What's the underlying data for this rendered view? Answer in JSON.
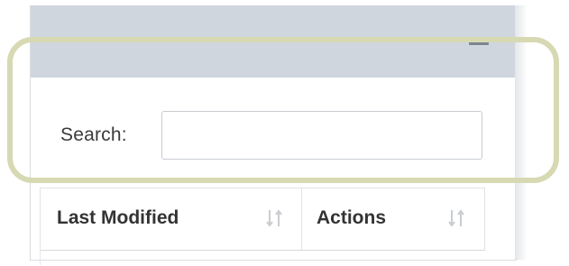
{
  "panel": {
    "minimize_icon": "minimize-icon"
  },
  "search": {
    "label": "Search:",
    "value": "",
    "placeholder": ""
  },
  "table": {
    "columns": [
      {
        "label": "Last Modified",
        "sort_icon": "sort-icon"
      },
      {
        "label": "Actions",
        "sort_icon": "sort-icon"
      }
    ]
  },
  "colors": {
    "header_bg": "#cfd6de",
    "highlight_outline": "#d7d9b3",
    "sort_icon": "#c9ccd0"
  }
}
